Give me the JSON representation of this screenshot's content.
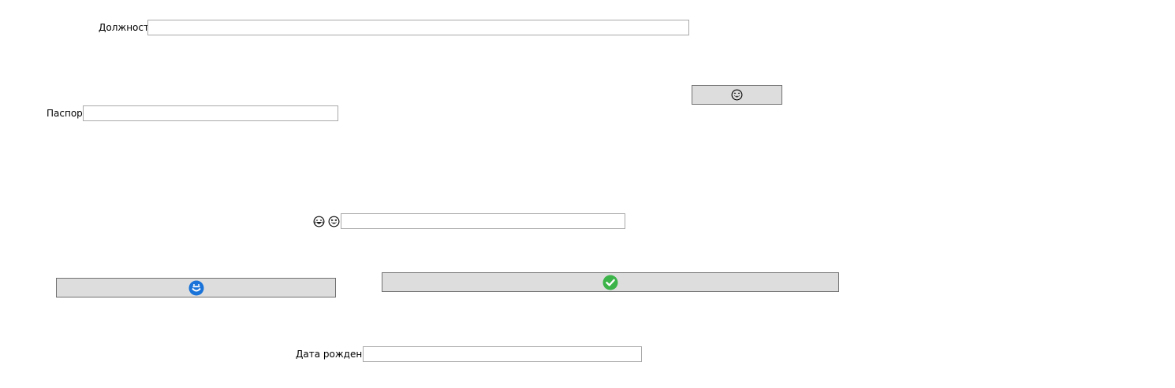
{
  "form": {
    "position_label": "Должность",
    "position_value": "",
    "passport_label": "Паспорт",
    "passport_value": "",
    "emoji_field_value": "",
    "birthdate_label": "Дата рождения",
    "birthdate_value": ""
  },
  "icons": {
    "top_button_icon": "grinning-face-with-sweat-icon",
    "left_emoji_icon": "face-with-tears-of-joy-icon",
    "right_emoji_icon": "grinning-squinting-face-icon",
    "cancel_icon": "cancel-circle-icon",
    "confirm_icon": "check-circle-icon"
  },
  "colors": {
    "button_bg": "#dddddd",
    "button_border": "#707070",
    "field_border": "#a9a9a9",
    "confirm_green": "#3cb44a",
    "cancel_blue": "#1a73d9"
  }
}
